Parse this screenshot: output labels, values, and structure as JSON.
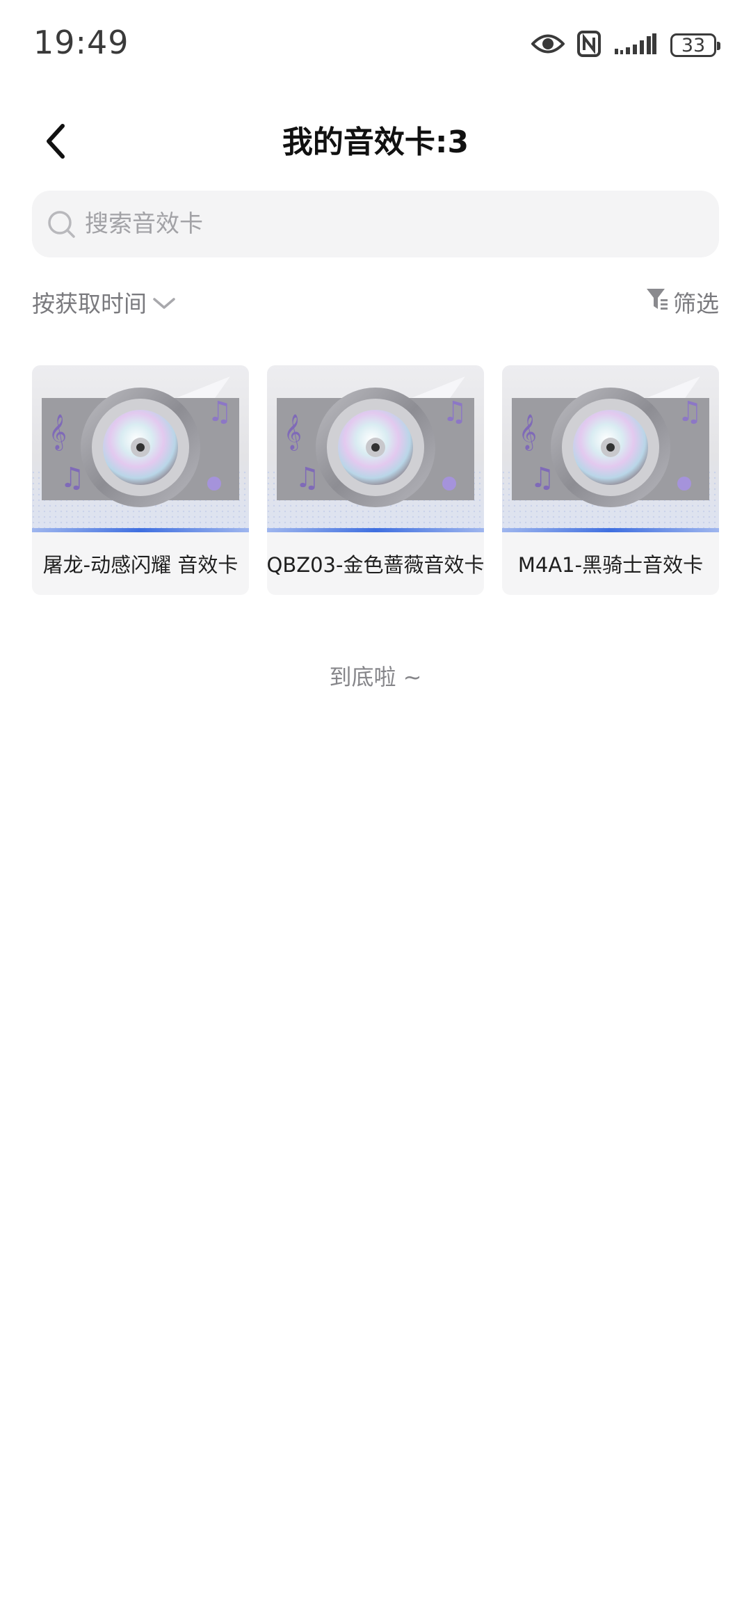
{
  "status_bar": {
    "time": "19:49",
    "battery_level": "33",
    "icons": [
      "eye-icon",
      "nfc-icon",
      "signal-icon",
      "battery-icon"
    ]
  },
  "header": {
    "title": "我的音效卡:3",
    "back_icon": "chevron-left-icon"
  },
  "search": {
    "placeholder": "搜索音效卡",
    "value": ""
  },
  "sort": {
    "label": "按获取时间",
    "icon": "chevron-down-icon"
  },
  "filter": {
    "label": "筛选",
    "icon": "filter-icon"
  },
  "cards": [
    {
      "label": "屠龙-动感闪耀 音效卡",
      "thumbnail": "disc-speaker-image"
    },
    {
      "label": "QBZ03-金色蔷薇音效卡",
      "thumbnail": "disc-speaker-image"
    },
    {
      "label": "M4A1-黑骑士音效卡",
      "thumbnail": "disc-speaker-image"
    }
  ],
  "end_text": "到底啦 ~",
  "colors": {
    "accent_blue": "#3f6fe0",
    "card_bg": "#f5f5f6",
    "muted_text": "#7a7a7e"
  }
}
